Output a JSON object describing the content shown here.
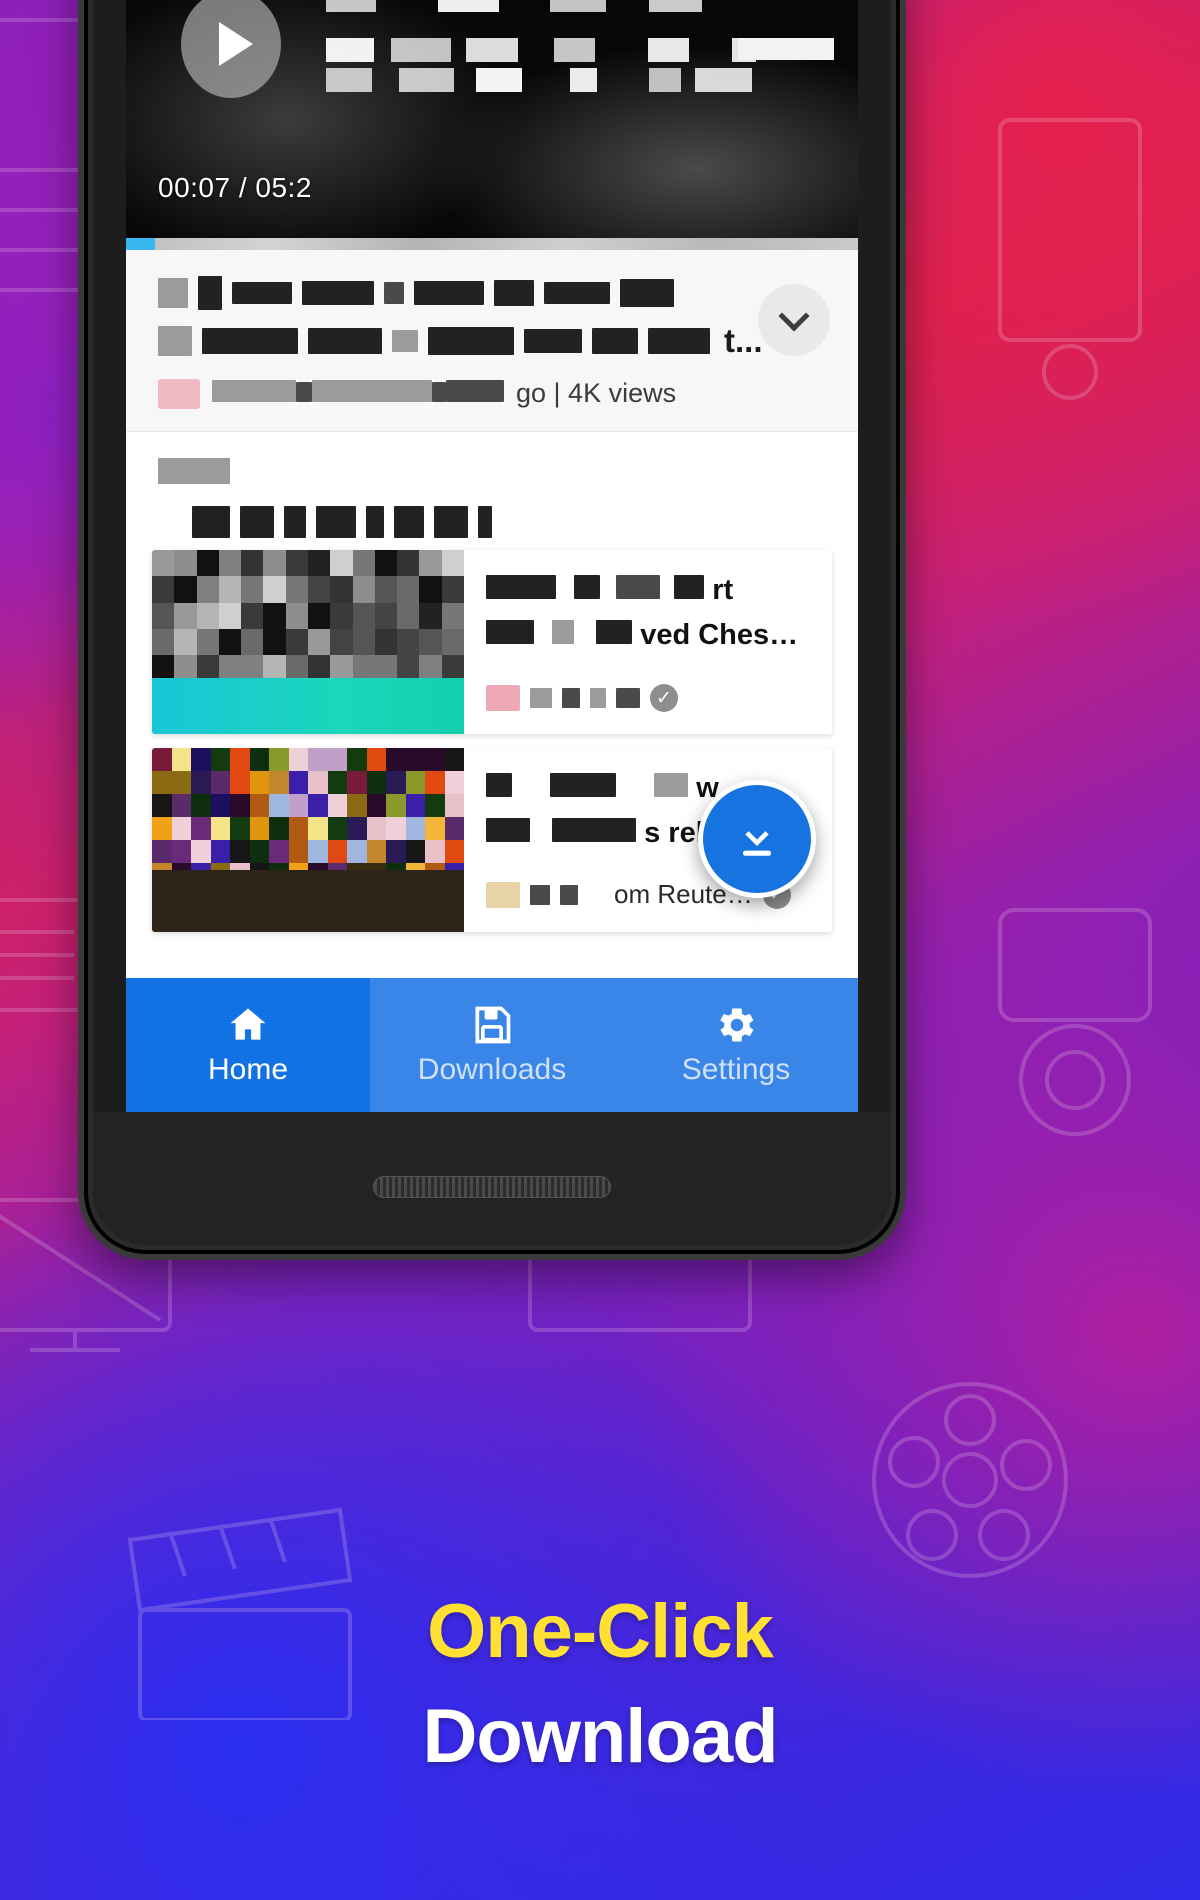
{
  "headline": {
    "line1": "One-Click",
    "line2": "Download",
    "accent_color": "#ffe033"
  },
  "phone": {
    "player": {
      "play_icon": "play-icon",
      "timecode": "00:07 / 05:2",
      "progress_percent": 4,
      "progress_color": "#37b6f0"
    },
    "video_info": {
      "title_line1_redacted": "██ ██ ████ ██ ███ ██",
      "title_line2_visible": "t...",
      "expand_icon": "chevron-down-icon",
      "meta_visible": "go  |  4K views"
    },
    "related": {
      "section_label_redacted": "████",
      "section_heading_redacted": "██ ██ █ ██ █ ███",
      "items": [
        {
          "title_visible": "rt",
          "title_visible2": "ved Ches…",
          "verified_icon": "verified-check-icon",
          "thumb_style": "grayscale-mosaic",
          "thumb_accent": "#1ad6bb"
        },
        {
          "title_visible": "w",
          "title_visible2": "s relief…",
          "source_visible": "om Reute…",
          "verified_icon": "verified-check-icon",
          "thumb_style": "color-mosaic",
          "thumb_accent": "#3a2a22"
        }
      ]
    },
    "fab": {
      "icon": "download-icon",
      "color": "#1773e0"
    },
    "nav": {
      "items": [
        {
          "label": "Home",
          "icon": "home-icon",
          "active": true
        },
        {
          "label": "Downloads",
          "icon": "save-disk-icon",
          "active": false
        },
        {
          "label": "Settings",
          "icon": "gear-icon",
          "active": false
        }
      ],
      "active_color": "#1272e3",
      "bar_color": "#3a86e8"
    }
  }
}
